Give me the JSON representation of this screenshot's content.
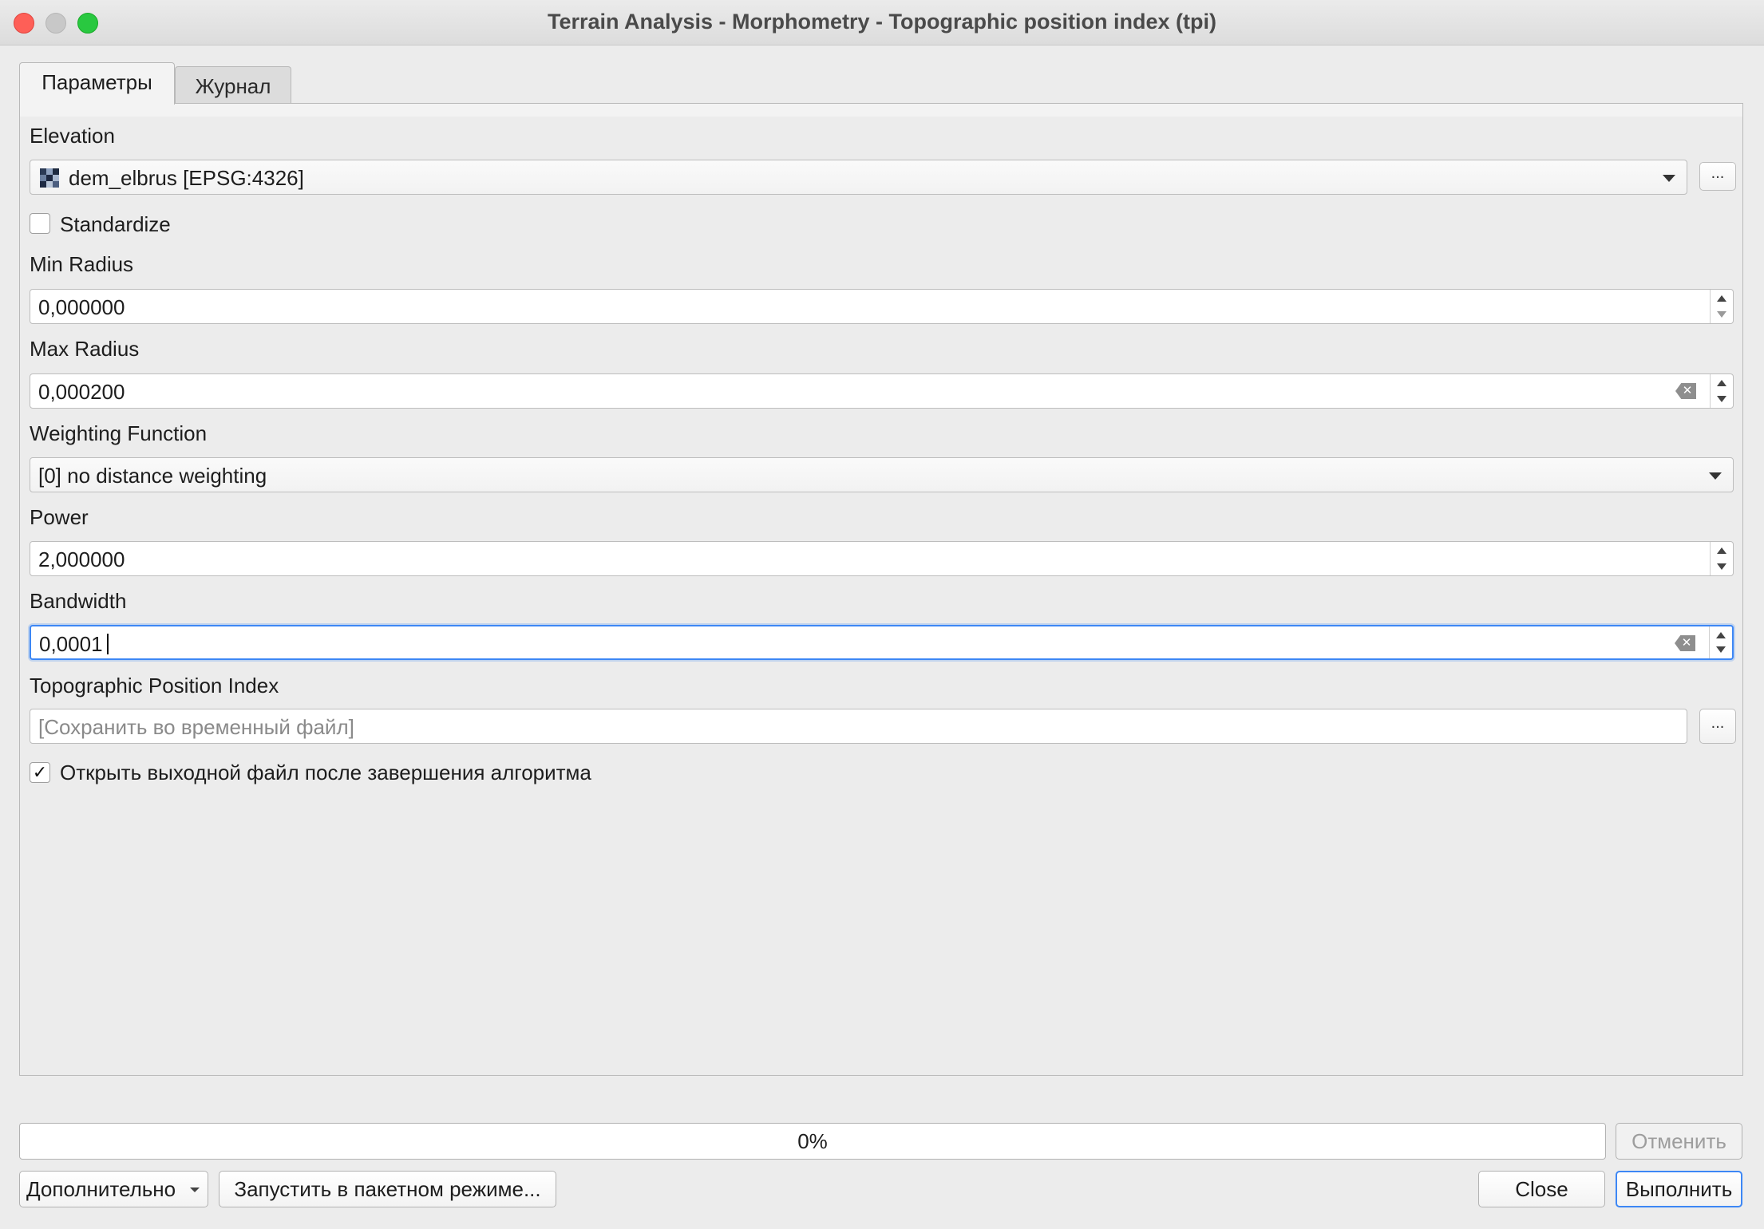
{
  "window": {
    "title": "Terrain Analysis - Morphometry - Topographic position index (tpi)"
  },
  "tabs": [
    {
      "label": "Параметры",
      "active": true
    },
    {
      "label": "Журнал",
      "active": false
    }
  ],
  "form": {
    "elevation": {
      "label": "Elevation",
      "value": "dem_elbrus [EPSG:4326]",
      "browse": "..."
    },
    "standardize": {
      "label": "Standardize",
      "checked": false
    },
    "min_radius": {
      "label": "Min Radius",
      "value": "0,000000"
    },
    "max_radius": {
      "label": "Max Radius",
      "value": "0,000200"
    },
    "weighting_function": {
      "label": "Weighting Function",
      "value": "[0] no distance weighting"
    },
    "power": {
      "label": "Power",
      "value": "2,000000"
    },
    "bandwidth": {
      "label": "Bandwidth",
      "value": "0,0001"
    },
    "tpi_output": {
      "label": "Topographic Position Index",
      "placeholder": "[Сохранить во временный файл]",
      "browse": "..."
    },
    "open_output": {
      "label": "Открыть выходной файл после завершения алгоритма",
      "checked": true,
      "check_mark": "✓"
    }
  },
  "progress": {
    "text": "0%",
    "value": 0
  },
  "buttons": {
    "cancel": "Отменить",
    "advanced": "Дополнительно",
    "batch": "Запустить в пакетном режиме...",
    "close": "Close",
    "run": "Выполнить"
  },
  "colors": {
    "focus": "#3d87f5",
    "close_light": "#fe5f57",
    "maximize_light": "#29c840"
  }
}
